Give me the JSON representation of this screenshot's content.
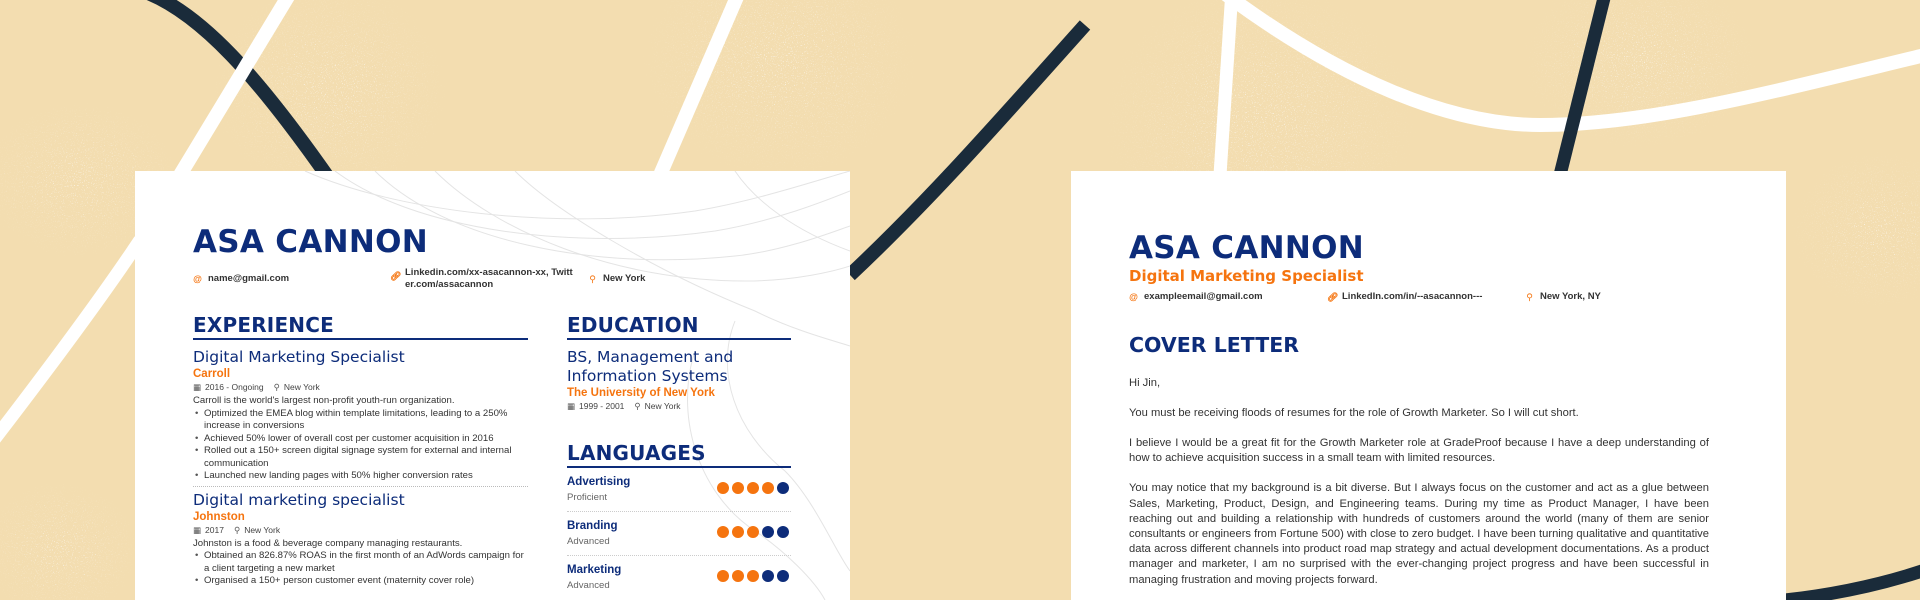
{
  "colors": {
    "background": "#f3ddb0",
    "navy": "#0d2c7a",
    "orange": "#f5740f",
    "dark_stroke": "#1a2b3a",
    "white_stroke": "#ffffff"
  },
  "resume": {
    "name": "ASA CANNON",
    "contacts": [
      {
        "icon": "at-icon",
        "text": "name@gmail.com"
      },
      {
        "icon": "link-icon",
        "text": "Linkedin.com/xx-asacannon-xx, Twitter.com/assacannon",
        "line1": "Linkedin.com/xx-asacannon-xx, Twitt",
        "line2": "er.com/assacannon"
      },
      {
        "icon": "location-pin-icon",
        "text": "New York"
      }
    ],
    "experience": {
      "title": "EXPERIENCE",
      "jobs": [
        {
          "title": "Digital Marketing Specialist",
          "company": "Carroll",
          "dates": "2016 - Ongoing",
          "location": "New York",
          "description": "Carroll is the world's largest non-profit youth-run organization.",
          "bullets": [
            "Optimized the EMEA blog within template limitations, leading to a 250% increase in conversions",
            "Achieved 50% lower of overall cost per customer acquisition in 2016",
            "Rolled out a 150+ screen digital signage system for external and internal communication",
            "Launched new landing pages with 50% higher conversion rates"
          ]
        },
        {
          "title": "Digital marketing specialist",
          "company": "Johnston",
          "dates": "2017",
          "location": "New York",
          "description": "Johnston is a food & beverage company managing restaurants.",
          "bullets": [
            "Obtained an 826.87% ROAS in the first month of an AdWords campaign for a client targeting a new market",
            "Organised a 150+ person customer event (maternity cover role)"
          ]
        }
      ]
    },
    "education": {
      "title": "EDUCATION",
      "degree": "BS, Management and Information Systems",
      "school": "The University of New York",
      "dates": "1999 - 2001",
      "location": "New York"
    },
    "languages": {
      "title": "LANGUAGES",
      "items": [
        {
          "name": "Advertising",
          "level": "Proficient",
          "rating": 4,
          "max": 5
        },
        {
          "name": "Branding",
          "level": "Advanced",
          "rating": 3,
          "max": 5
        },
        {
          "name": "Marketing",
          "level": "Advanced",
          "rating": 3,
          "max": 5
        }
      ]
    }
  },
  "cover": {
    "name": "ASA CANNON",
    "subtitle": "Digital Marketing Specialist",
    "contacts": [
      {
        "icon": "at-icon",
        "text": "exampleemail@gmail.com"
      },
      {
        "icon": "link-icon",
        "text": "LinkedIn.com/in/--asacannon---"
      },
      {
        "icon": "location-pin-icon",
        "text": "New York, NY"
      }
    ],
    "section_title": "COVER LETTER",
    "greeting": "Hi Jin,",
    "paragraphs": [
      "You must be receiving floods of resumes for the role of Growth Marketer. So I will cut short.",
      "I believe I would be a great fit for the Growth Marketer role at GradeProof because I have a deep understanding of how to achieve acquisition success in a small team with limited resources.",
      "You may notice that my background is a bit diverse. But I always focus on the customer and act as a glue between Sales, Marketing, Product, Design, and Engineering teams. During my time as Product Manager, I have been reaching out and building a relationship with hundreds of customers around the world (many of them are senior consultants or engineers from Fortune 500) with close to zero budget. I have been turning qualitative and quantitative data across different channels into product road map strategy and actual development documentations. As a product manager and marketer, I am no surprised with the ever-changing project progress and have been successful in managing frustration and moving projects forward."
    ]
  }
}
